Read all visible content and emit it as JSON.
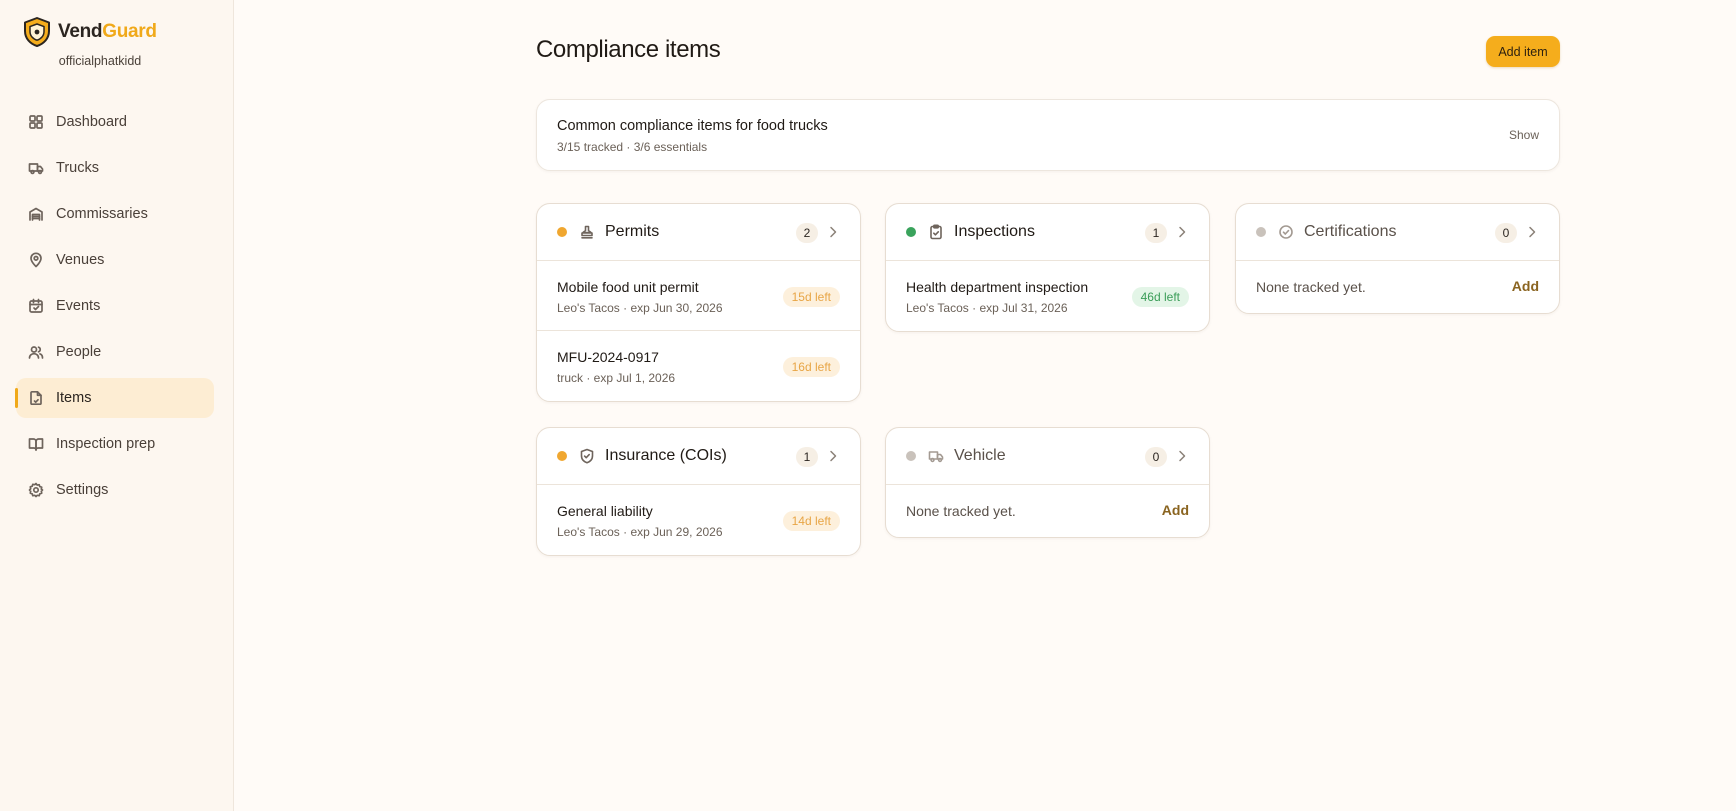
{
  "brand": {
    "name_part1": "Vend",
    "name_part2": "Guard",
    "account": "officialphatkidd"
  },
  "nav": [
    {
      "label": "Dashboard",
      "icon": "grid-icon"
    },
    {
      "label": "Trucks",
      "icon": "truck-icon"
    },
    {
      "label": "Commissaries",
      "icon": "warehouse-icon"
    },
    {
      "label": "Venues",
      "icon": "map-pin-icon"
    },
    {
      "label": "Events",
      "icon": "calendar-check-icon"
    },
    {
      "label": "People",
      "icon": "users-icon"
    },
    {
      "label": "Items",
      "icon": "file-icon",
      "active": true
    },
    {
      "label": "Inspection prep",
      "icon": "book-open-icon"
    },
    {
      "label": "Settings",
      "icon": "gear-icon"
    }
  ],
  "page": {
    "title": "Compliance items",
    "add_button": "Add item"
  },
  "banner": {
    "title": "Common compliance items for food trucks",
    "subtitle": "3/15 tracked · 3/6 essentials",
    "toggle": "Show"
  },
  "colors": {
    "accent": "#f5ad1c",
    "warn": "#e8a545",
    "ok": "#3a9d58",
    "inactive": "#c9c2bb"
  },
  "categories": {
    "permits": {
      "title": "Permits",
      "count": "2",
      "status": "warn",
      "icon": "stamp-icon",
      "items": [
        {
          "title": "Mobile food unit permit",
          "sub": "Leo's Tacos · exp Jun 30, 2026",
          "badge": "15d left"
        },
        {
          "title": "MFU-2024-0917",
          "sub": "truck · exp Jul 1, 2026",
          "badge": "16d left"
        }
      ]
    },
    "inspections": {
      "title": "Inspections",
      "count": "1",
      "status": "ok",
      "icon": "clipboard-check-icon",
      "items": [
        {
          "title": "Health department inspection",
          "sub": "Leo's Tacos · exp Jul 31, 2026",
          "badge": "46d left"
        }
      ]
    },
    "certifications": {
      "title": "Certifications",
      "count": "0",
      "status": "inactive",
      "icon": "badge-check-icon",
      "empty_text": "None tracked yet.",
      "add_label": "Add"
    },
    "insurance": {
      "title": "Insurance (COIs)",
      "count": "1",
      "status": "warn",
      "icon": "shield-check-icon",
      "items": [
        {
          "title": "General liability",
          "sub": "Leo's Tacos · exp Jun 29, 2026",
          "badge": "14d left"
        }
      ]
    },
    "vehicle": {
      "title": "Vehicle",
      "count": "0",
      "status": "inactive",
      "icon": "truck-icon",
      "empty_text": "None tracked yet.",
      "add_label": "Add"
    }
  }
}
